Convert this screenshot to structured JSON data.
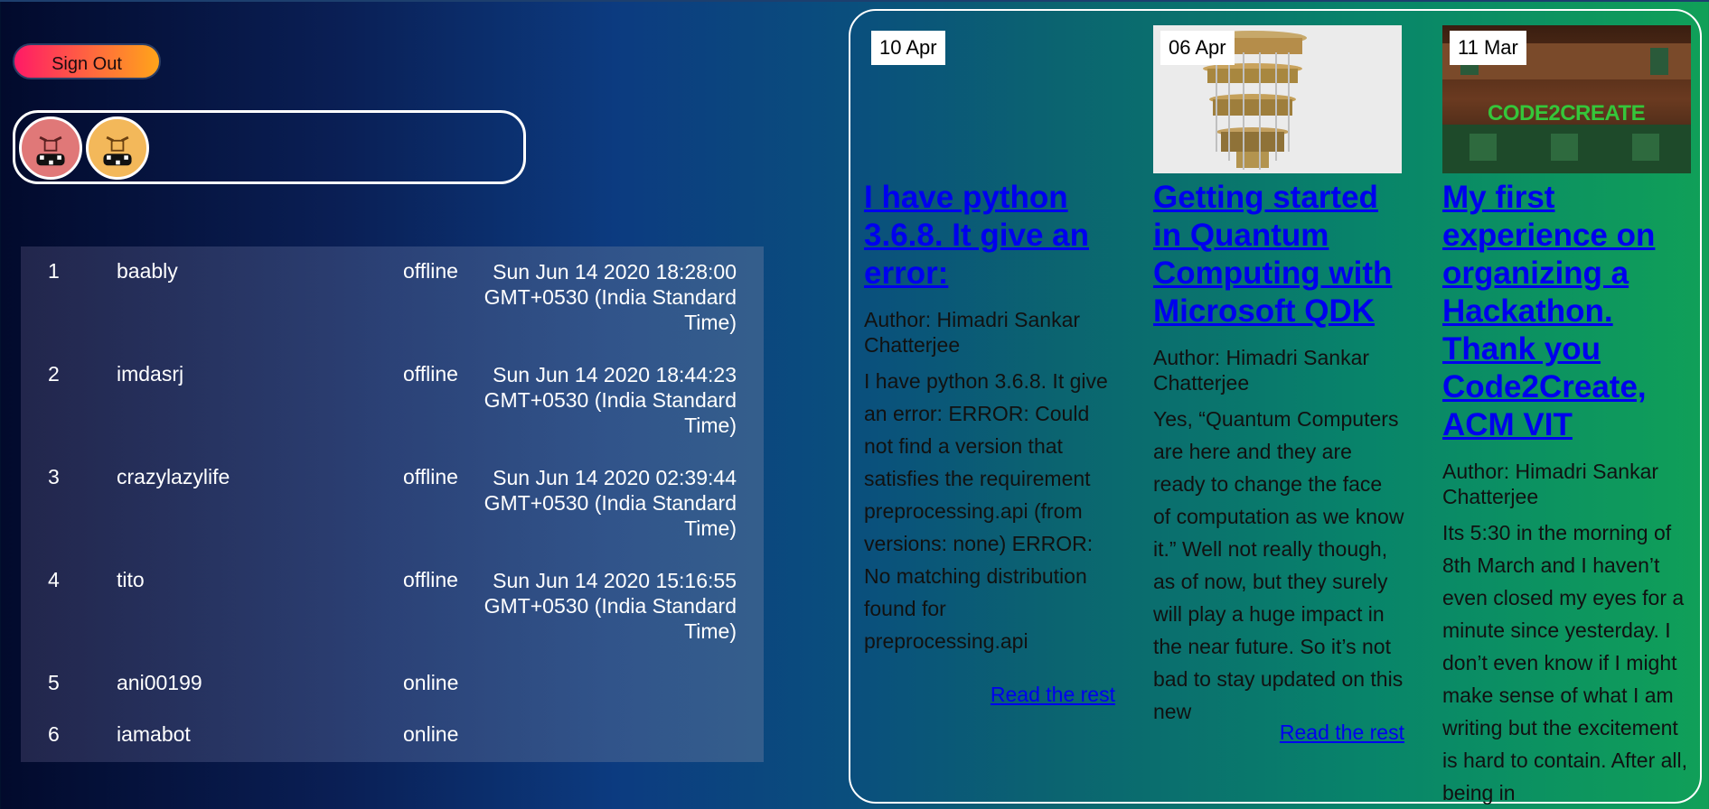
{
  "signout_label": "Sign Out",
  "avatars": [
    "avatar-pink",
    "avatar-orange"
  ],
  "users": [
    {
      "rank": "1",
      "name": "baably",
      "status": "offline",
      "last_seen": "Sun Jun 14 2020 18:28:00 GMT+0530 (India Standard Time)"
    },
    {
      "rank": "2",
      "name": "imdasrj",
      "status": "offline",
      "last_seen": "Sun Jun 14 2020 18:44:23 GMT+0530 (India Standard Time)"
    },
    {
      "rank": "3",
      "name": "crazylazylife",
      "status": "offline",
      "last_seen": "Sun Jun 14 2020 02:39:44 GMT+0530 (India Standard Time)"
    },
    {
      "rank": "4",
      "name": "tito",
      "status": "offline",
      "last_seen": "Sun Jun 14 2020 15:16:55 GMT+0530 (India Standard Time)"
    },
    {
      "rank": "5",
      "name": "ani00199",
      "status": "online",
      "last_seen": ""
    },
    {
      "rank": "6",
      "name": "iamabot",
      "status": "online",
      "last_seen": ""
    }
  ],
  "posts": [
    {
      "date": "10 Apr",
      "title": "I have python 3.6.8. It give an error:",
      "author": "Author: Himadri Sankar Chatterjee",
      "body": "I have python 3.6.8. It give an error: ERROR: Could not find a version that satisfies the requirement preprocessing.api (from versions: none) ERROR: No matching distribution found for preprocessing.api",
      "read_more": "Read the rest"
    },
    {
      "date": "06 Apr",
      "title": "Getting started in Quantum Computing with Microsoft QDK",
      "author": "Author: Himadri Sankar Chatterjee",
      "body": "Yes, “Quantum Computers are here and they are ready to change the face of computation as we know it.” Well not really though, as of now, but they surely will play a huge impact in the near future. So it’s not bad to stay updated on this new",
      "read_more": "Read the rest"
    },
    {
      "date": "11 Mar",
      "title": "My first experience on organizing a Hackathon. Thank you Code2Create, ACM VIT",
      "author": "Author: Himadri Sankar Chatterjee",
      "body": "Its 5:30 in the morning of 8th March and I haven’t even closed my eyes for a minute since yesterday. I don’t even know if I might make sense of what I am writing but the excitement is hard to contain. After all, being in",
      "read_more": "",
      "image_text": "CODE2CREATE"
    }
  ]
}
